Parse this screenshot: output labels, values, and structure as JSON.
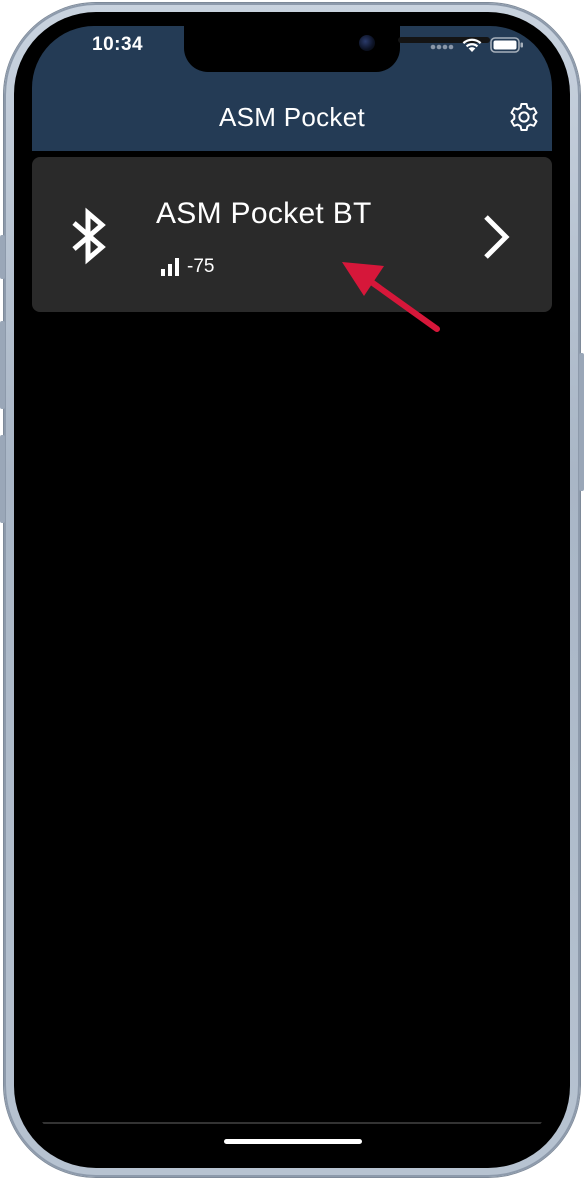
{
  "status_bar": {
    "time": "10:34",
    "icons": [
      "cellular-dots-icon",
      "wifi-icon",
      "battery-icon"
    ]
  },
  "header": {
    "title": "ASM Pocket",
    "settings_icon": "gear-icon",
    "background_color": "#243b55"
  },
  "device_list": {
    "items": [
      {
        "name": "ASM Pocket BT",
        "rssi": "-75",
        "icon": "bluetooth-icon",
        "signal_icon": "signal-bars-icon",
        "action_icon": "chevron-right-icon"
      }
    ]
  },
  "annotation": {
    "type": "arrow",
    "color": "#d6173a"
  }
}
